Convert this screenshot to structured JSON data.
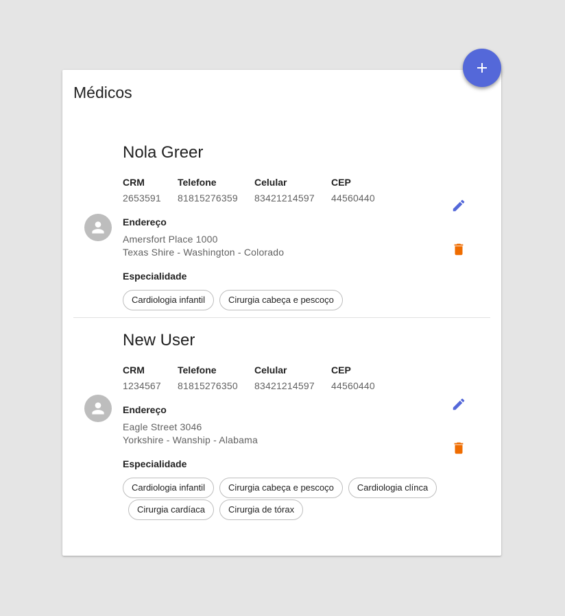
{
  "page": {
    "title": "Médicos"
  },
  "colors": {
    "accent": "#5468d9",
    "edit_icon": "#5468d9",
    "delete_icon": "#ef6c00",
    "avatar_bg": "#bdbdbd"
  },
  "labels": {
    "crm": "CRM",
    "telefone": "Telefone",
    "celular": "Celular",
    "cep": "CEP",
    "endereco": "Endereço",
    "especialidade": "Especialidade"
  },
  "doctors": [
    {
      "name": "Nola Greer",
      "crm": "2653591",
      "telefone": "81815276359",
      "celular": "83421214597",
      "cep": "44560440",
      "endereco_line1": "Amersfort Place 1000",
      "endereco_line2": "Texas Shire - Washington - Colorado",
      "especialidades": [
        "Cardiologia infantil",
        "Cirurgia cabeça e pescoço"
      ]
    },
    {
      "name": "New User",
      "crm": "1234567",
      "telefone": "81815276350",
      "celular": "83421214597",
      "cep": "44560440",
      "endereco_line1": "Eagle Street 3046",
      "endereco_line2": "Yorkshire - Wanship - Alabama",
      "especialidades": [
        "Cardiologia infantil",
        "Cirurgia cabeça e pescoço",
        "Cardiologia clínca",
        "Cirurgia cardíaca",
        "Cirurgia de tórax"
      ]
    }
  ],
  "icons": {
    "add": "plus-icon",
    "edit": "pencil-icon",
    "delete": "trash-icon",
    "avatar": "person-icon"
  }
}
